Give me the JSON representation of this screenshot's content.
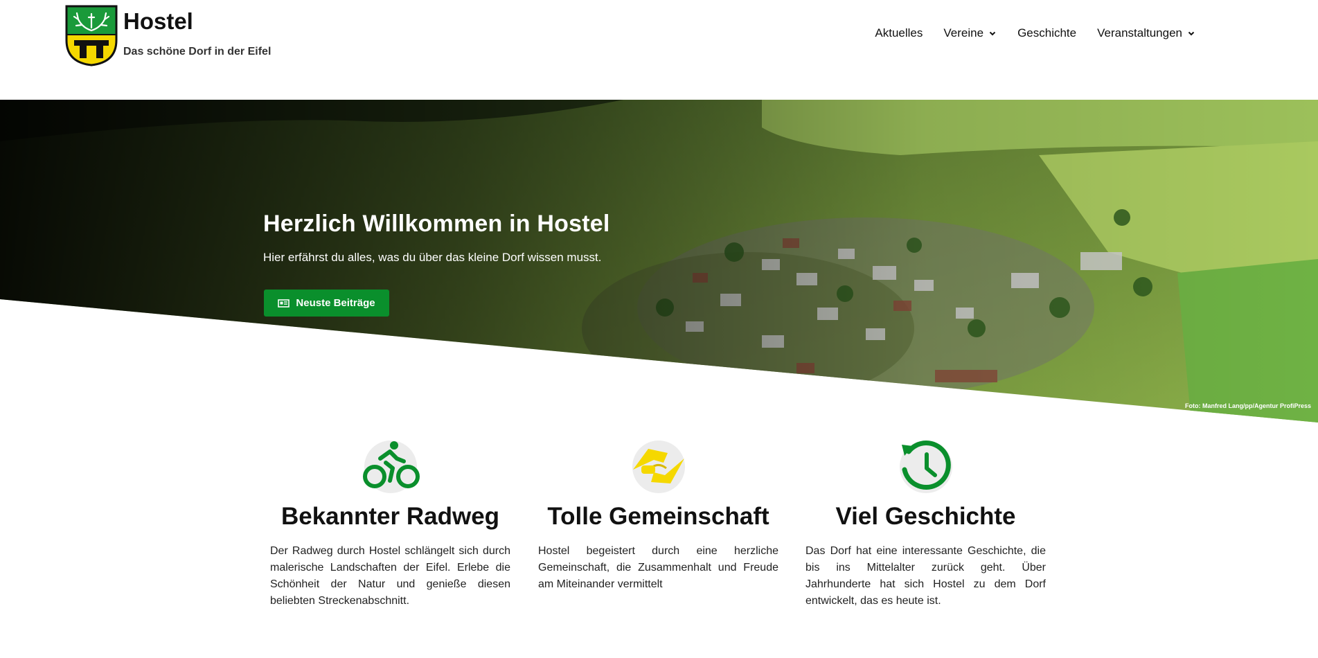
{
  "site": {
    "title": "Hostel",
    "tagline": "Das schöne Dorf in der Eifel"
  },
  "nav": {
    "items": [
      {
        "label": "Aktuelles",
        "dropdown": false
      },
      {
        "label": "Vereine",
        "dropdown": true
      },
      {
        "label": "Geschichte",
        "dropdown": false
      },
      {
        "label": "Veranstaltungen",
        "dropdown": true
      }
    ]
  },
  "hero": {
    "title": "Herzlich Willkommen in Hostel",
    "subtitle": "Hier erfährst du alles, was du über das kleine Dorf wissen musst.",
    "button_label": "Neuste Beiträge",
    "button_icon": "newspaper-icon",
    "credit": "Foto: Manfred Lang/pp/Agentur ProfiPress"
  },
  "features": [
    {
      "icon": "bicycle-icon",
      "title": "Bekannter Radweg",
      "text": "Der Radweg durch Hostel schlängelt sich durch malerische Landschaften der Eifel. Erlebe die Schönheit der Natur und genieße diesen beliebten Streckenabschnitt."
    },
    {
      "icon": "handshake-icon",
      "title": "Tolle Gemeinschaft",
      "text": "Hostel begeistert durch eine herzliche Gemeinschaft, die Zusammenhalt und Freude am Miteinander vermittelt"
    },
    {
      "icon": "history-icon",
      "title": "Viel Geschichte",
      "text": "Das Dorf hat eine interessante Geschichte, die bis ins Mittelalter zurück geht. Über Jahrhunderte hat sich Hostel zu dem Dorf entwickelt, das es heute ist."
    }
  ],
  "colors": {
    "accent_green": "#0a8f2c",
    "accent_yellow": "#f5d800"
  }
}
